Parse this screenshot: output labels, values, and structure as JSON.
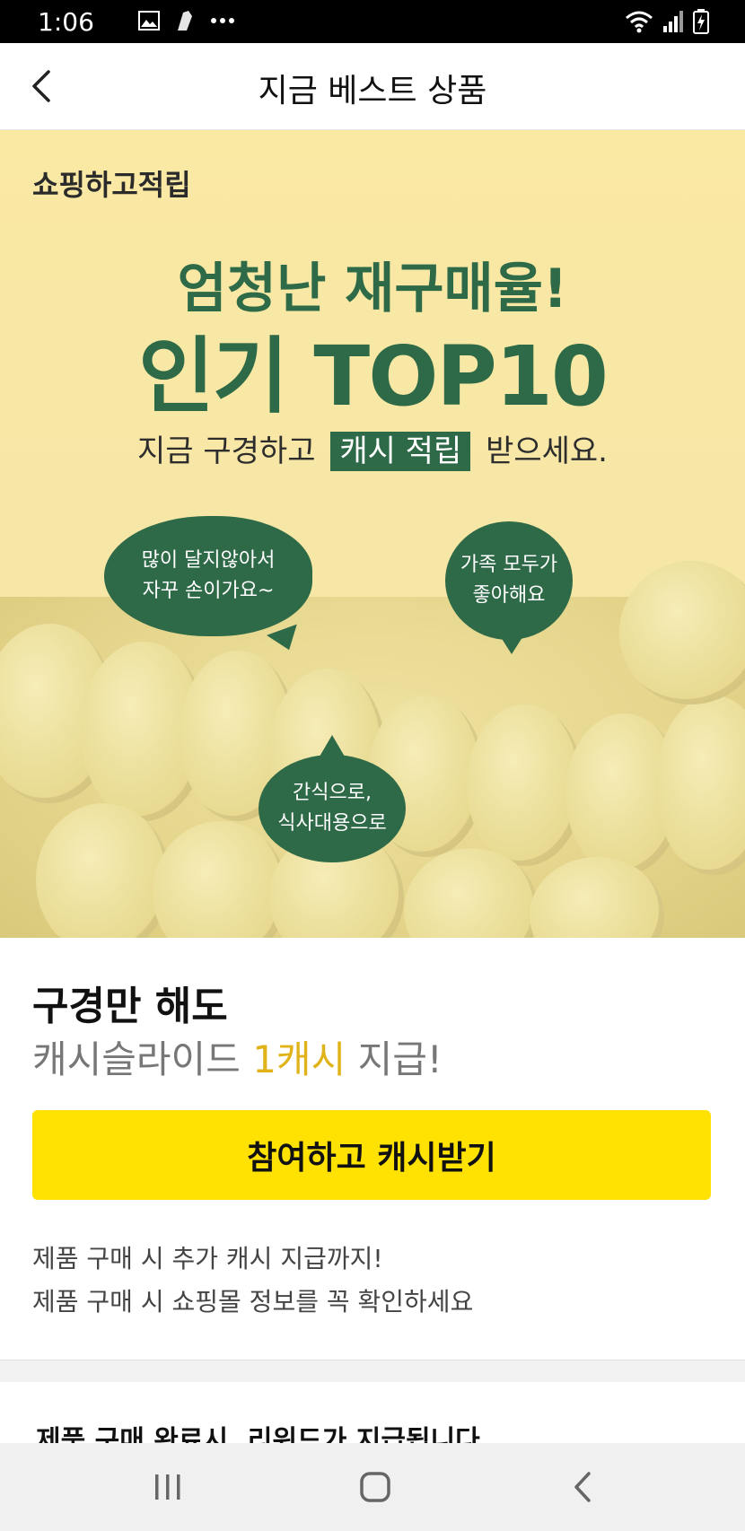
{
  "status_bar": {
    "time": "1:06"
  },
  "header": {
    "title": "지금 베스트 상품",
    "back_icon": "chevron-left-icon"
  },
  "banner": {
    "brand": "쇼핑하고적립",
    "headline_1": "엄청난 재구매율!",
    "headline_2": "인기 TOP10",
    "subline_before": "지금 구경하고",
    "subline_highlight": "캐시 적립",
    "subline_after": "받으세요.",
    "bubbles": [
      {
        "line1": "많이 달지않아서",
        "line2": "자꾸 손이가요~"
      },
      {
        "line1": "가족 모두가",
        "line2": "좋아해요"
      },
      {
        "line1": "간식으로,",
        "line2": "식사대용으로"
      }
    ],
    "colors": {
      "green": "#2e6a47",
      "background": "#f7e7a7"
    }
  },
  "promo": {
    "title": "구경만 해도",
    "subtitle_before": "캐시슬라이드",
    "subtitle_accent": "1캐시",
    "subtitle_after": "지급!",
    "cta_label": "참여하고 캐시받기",
    "note_1": "제품 구매 시 추가 캐시 지급까지!",
    "note_2": "제품 구매 시 쇼핑몰 정보를 꼭 확인하세요",
    "colors": {
      "cta": "#ffe201",
      "accent": "#e0b31a"
    }
  },
  "reward_notice": "제품 구매 완료시, 리워드가 지급됩니다.",
  "nav": {
    "recent_icon": "recent-apps-icon",
    "home_icon": "home-icon",
    "back_icon": "back-icon"
  }
}
